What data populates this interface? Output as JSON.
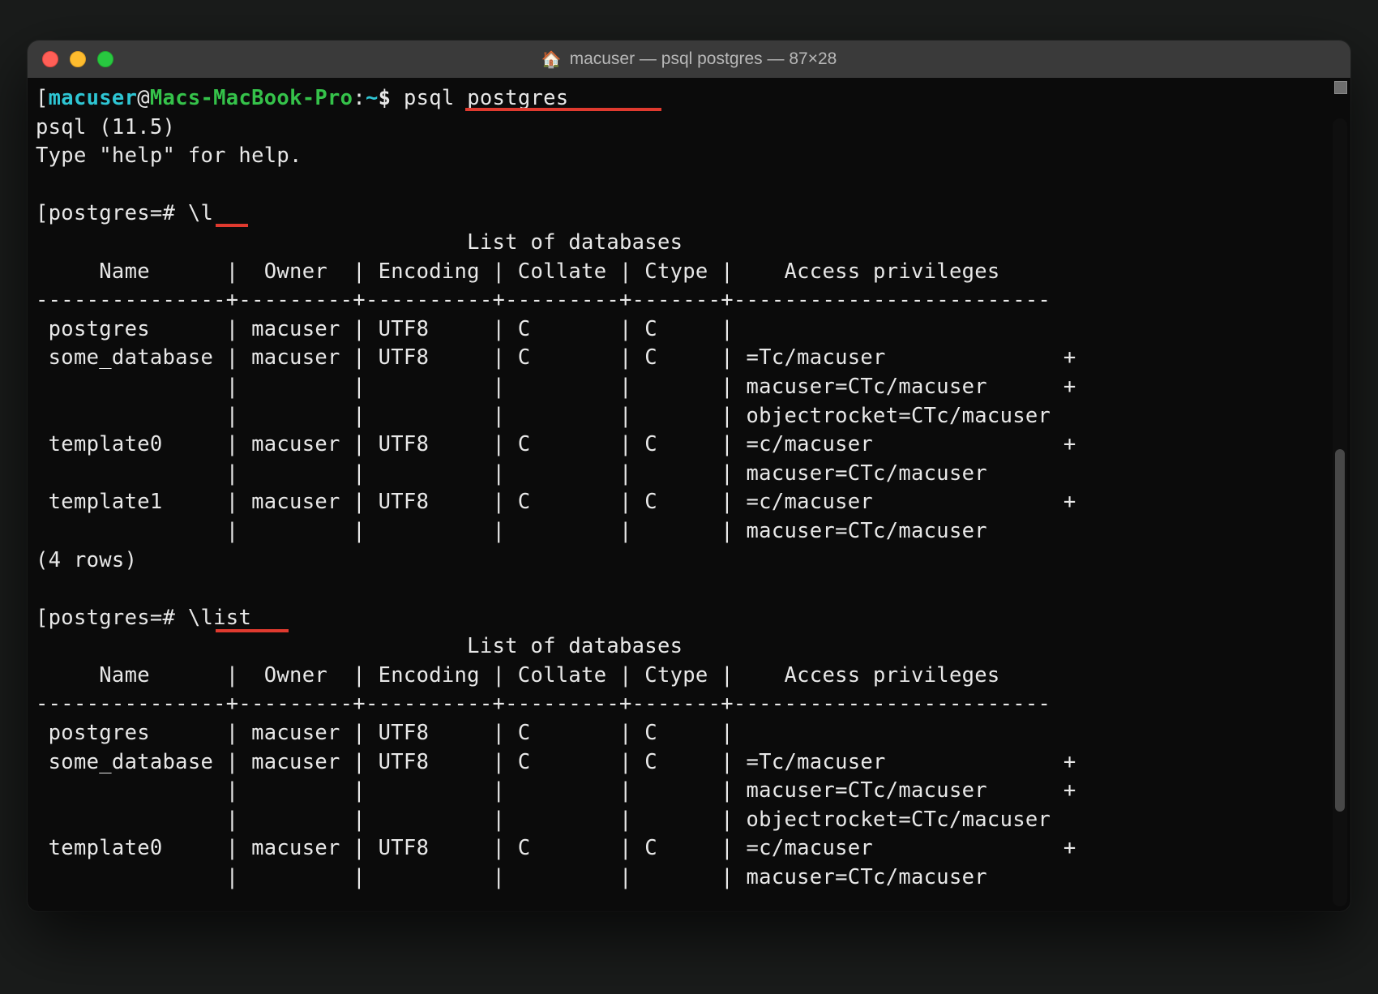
{
  "window": {
    "title": "macuser — psql postgres — 87×28"
  },
  "prompt1": {
    "user": "macuser",
    "at": "@",
    "host": "Macs-MacBook-Pro",
    "sep": ":",
    "path": "~",
    "sigil": "$ ",
    "cmd": "psql postgres"
  },
  "psql": {
    "version_line": "psql (11.5)",
    "help_line": "Type \"help\" for help."
  },
  "inner_prompt": "postgres=# ",
  "cmd_l": "\\l",
  "cmd_list": "\\list",
  "table": {
    "title": "                                  List of databases",
    "header": "     Name      |  Owner  | Encoding | Collate | Ctype |    Access privileges    ",
    "divider": "---------------+---------+----------+---------+-------+-------------------------",
    "rows1": [
      " postgres      | macuser | UTF8     | C       | C     | ",
      " some_database | macuser | UTF8     | C       | C     | =Tc/macuser              +",
      "               |         |          |         |       | macuser=CTc/macuser      +",
      "               |         |          |         |       | objectrocket=CTc/macuser",
      " template0     | macuser | UTF8     | C       | C     | =c/macuser               +",
      "               |         |          |         |       | macuser=CTc/macuser",
      " template1     | macuser | UTF8     | C       | C     | =c/macuser               +",
      "               |         |          |         |       | macuser=CTc/macuser"
    ],
    "rowcount": "(4 rows)",
    "rows2": [
      " postgres      | macuser | UTF8     | C       | C     | ",
      " some_database | macuser | UTF8     | C       | C     | =Tc/macuser              +",
      "               |         |          |         |       | macuser=CTc/macuser      +",
      "               |         |          |         |       | objectrocket=CTc/macuser",
      " template0     | macuser | UTF8     | C       | C     | =c/macuser               +",
      "               |         |          |         |       | macuser=CTc/macuser"
    ]
  },
  "bracket": "[",
  "bracket_r": "]"
}
